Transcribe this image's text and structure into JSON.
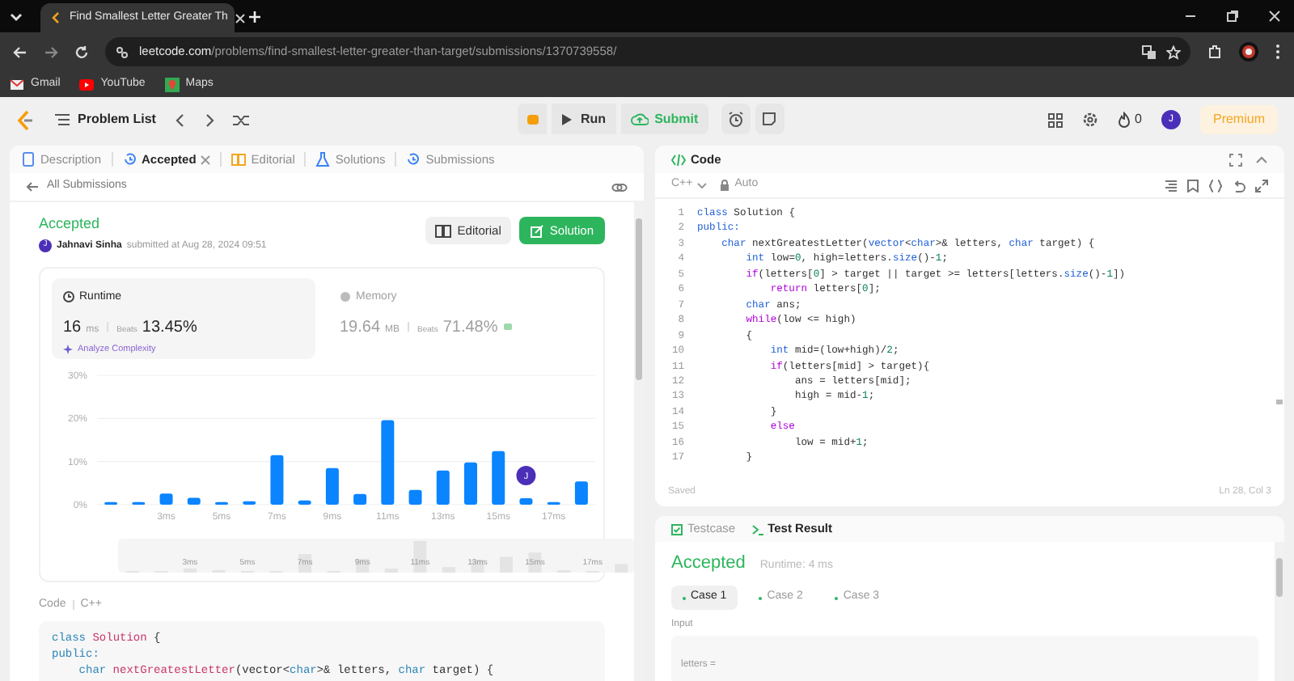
{
  "browser": {
    "tab_title": "Find Smallest Letter Greater Th",
    "url_host": "leetcode.com",
    "url_path": "/problems/find-smallest-letter-greater-than-target/submissions/1370739558/",
    "bookmarks": [
      "Gmail",
      "YouTube",
      "Maps"
    ]
  },
  "nav": {
    "problem_list": "Problem List",
    "run": "Run",
    "submit": "Submit",
    "streak": "0",
    "avatar": "J",
    "premium": "Premium"
  },
  "left_tabs": [
    {
      "label": "Description",
      "selected": false,
      "closable": false
    },
    {
      "label": "Accepted",
      "selected": true,
      "closable": true
    },
    {
      "label": "Editorial",
      "selected": false,
      "closable": false
    },
    {
      "label": "Solutions",
      "selected": false,
      "closable": false
    },
    {
      "label": "Submissions",
      "selected": false,
      "closable": false
    }
  ],
  "back_link": "All Submissions",
  "submission": {
    "status": "Accepted",
    "avatar": "J",
    "user": "Jahnavi Sinha",
    "submitted": "submitted at Aug 28, 2024 09:51",
    "editorial": "Editorial",
    "solution": "Solution"
  },
  "runtime": {
    "label": "Runtime",
    "value": "16",
    "unit": "ms",
    "beats_label": "Beats",
    "beats": "13.45%",
    "analyze": "Analyze Complexity",
    "selected": true
  },
  "memory": {
    "label": "Memory",
    "value": "19.64",
    "unit": "MB",
    "beats_label": "Beats",
    "beats": "71.48%",
    "selected": false
  },
  "chart_data": {
    "type": "bar",
    "x": [
      1,
      2,
      3,
      4,
      5,
      6,
      7,
      8,
      9,
      10,
      11,
      12,
      13,
      14,
      15,
      16,
      17,
      18
    ],
    "xlim": [
      0.5,
      18.5
    ],
    "series": [
      {
        "color": "#0a84ff",
        "values": [
          0.6,
          0.6,
          2.6,
          1.6,
          0.6,
          0.8,
          11.5,
          1,
          8.5,
          2.5,
          19.6,
          3.4,
          7.9,
          9.8,
          12.4,
          1.5,
          0.6,
          5.4
        ]
      }
    ],
    "ylim": [
      0,
      30
    ],
    "yticks": [
      {
        "value": 0,
        "label": "0%"
      },
      {
        "value": 10,
        "label": "10%"
      },
      {
        "value": 20,
        "label": "20%"
      },
      {
        "value": 30,
        "label": "30%"
      }
    ],
    "xticks": [
      {
        "value": 3,
        "label": "3ms"
      },
      {
        "value": 5,
        "label": "5ms"
      },
      {
        "value": 7,
        "label": "7ms"
      },
      {
        "value": 9,
        "label": "9ms"
      },
      {
        "value": 11,
        "label": "11ms"
      },
      {
        "value": 13,
        "label": "13ms"
      },
      {
        "value": 15,
        "label": "15ms"
      },
      {
        "value": 17,
        "label": "17ms"
      }
    ],
    "annotations": [
      {
        "x": 16,
        "text": "J"
      }
    ]
  },
  "brush_labels": [
    "3ms",
    "5ms",
    "7ms",
    "9ms",
    "11ms",
    "13ms",
    "15ms",
    "17ms"
  ],
  "code_section": {
    "label": "Code",
    "language": "C++",
    "lines": [
      [
        {
          "text": "class",
          "kind": "keyword"
        },
        {
          "text": " Solution",
          "kind": "name"
        },
        {
          "text": " {",
          "kind": "plain"
        }
      ],
      [
        {
          "text": "public:",
          "kind": "keyword"
        }
      ],
      [
        {
          "text": "    char",
          "kind": "keyword"
        },
        {
          "text": " nextGreatestLetter",
          "kind": "name"
        },
        {
          "text": "(vector<",
          "kind": "plain"
        },
        {
          "text": "char",
          "kind": "keyword"
        },
        {
          "text": ">& letters, ",
          "kind": "plain"
        },
        {
          "text": "char",
          "kind": "keyword"
        },
        {
          "text": " target) {",
          "kind": "plain"
        }
      ]
    ]
  },
  "editor": {
    "title": "Code",
    "language": "C++",
    "mode": "Auto",
    "status": "Saved",
    "cursor": "Ln 28, Col 3",
    "lines": [
      {
        "number": "1",
        "tokens": [
          {
            "text": "class",
            "kind": "keyword"
          },
          {
            "text": " Solution {",
            "kind": "plain"
          }
        ]
      },
      {
        "number": "2",
        "tokens": [
          {
            "text": "public:",
            "kind": "keyword"
          }
        ]
      },
      {
        "number": "3",
        "tokens": [
          {
            "text": "    char",
            "kind": "keyword"
          },
          {
            "text": " nextGreatestLetter(",
            "kind": "plain"
          },
          {
            "text": "vector",
            "kind": "keyword"
          },
          {
            "text": "<",
            "kind": "plain"
          },
          {
            "text": "char",
            "kind": "keyword"
          },
          {
            "text": ">& letters, ",
            "kind": "plain"
          },
          {
            "text": "char",
            "kind": "keyword"
          },
          {
            "text": " target) {",
            "kind": "plain"
          }
        ]
      },
      {
        "number": "4",
        "tokens": [
          {
            "text": "        int",
            "kind": "keyword"
          },
          {
            "text": " low=",
            "kind": "plain"
          },
          {
            "text": "0",
            "kind": "number"
          },
          {
            "text": ", high=letters.",
            "kind": "plain"
          },
          {
            "text": "size",
            "kind": "keyword"
          },
          {
            "text": "()-",
            "kind": "plain"
          },
          {
            "text": "1",
            "kind": "number"
          },
          {
            "text": ";",
            "kind": "plain"
          }
        ]
      },
      {
        "number": "5",
        "tokens": [
          {
            "text": "        if",
            "kind": "control"
          },
          {
            "text": "(letters[",
            "kind": "plain"
          },
          {
            "text": "0",
            "kind": "number"
          },
          {
            "text": "] > target || target >= letters[letters.",
            "kind": "plain"
          },
          {
            "text": "size",
            "kind": "keyword"
          },
          {
            "text": "()-",
            "kind": "plain"
          },
          {
            "text": "1",
            "kind": "number"
          },
          {
            "text": "])",
            "kind": "plain"
          }
        ]
      },
      {
        "number": "6",
        "tokens": [
          {
            "text": "            return",
            "kind": "control"
          },
          {
            "text": " letters[",
            "kind": "plain"
          },
          {
            "text": "0",
            "kind": "number"
          },
          {
            "text": "];",
            "kind": "plain"
          }
        ]
      },
      {
        "number": "7",
        "tokens": [
          {
            "text": "        char",
            "kind": "keyword"
          },
          {
            "text": " ans;",
            "kind": "plain"
          }
        ]
      },
      {
        "number": "8",
        "tokens": [
          {
            "text": "        while",
            "kind": "control"
          },
          {
            "text": "(low <= high)",
            "kind": "plain"
          }
        ]
      },
      {
        "number": "9",
        "tokens": [
          {
            "text": "        {",
            "kind": "plain"
          }
        ]
      },
      {
        "number": "10",
        "tokens": [
          {
            "text": "            int",
            "kind": "keyword"
          },
          {
            "text": " mid=(low+high)/",
            "kind": "plain"
          },
          {
            "text": "2",
            "kind": "number"
          },
          {
            "text": ";",
            "kind": "plain"
          }
        ]
      },
      {
        "number": "11",
        "tokens": [
          {
            "text": "            if",
            "kind": "control"
          },
          {
            "text": "(letters[mid] > target){",
            "kind": "plain"
          }
        ]
      },
      {
        "number": "12",
        "tokens": [
          {
            "text": "                ans = letters[mid];",
            "kind": "plain"
          }
        ]
      },
      {
        "number": "13",
        "tokens": [
          {
            "text": "                high = mid-",
            "kind": "plain"
          },
          {
            "text": "1",
            "kind": "number"
          },
          {
            "text": ";",
            "kind": "plain"
          }
        ]
      },
      {
        "number": "14",
        "tokens": [
          {
            "text": "            }",
            "kind": "plain"
          }
        ]
      },
      {
        "number": "15",
        "tokens": [
          {
            "text": "            else",
            "kind": "control"
          }
        ]
      },
      {
        "number": "16",
        "tokens": [
          {
            "text": "                low = mid+",
            "kind": "plain"
          },
          {
            "text": "1",
            "kind": "number"
          },
          {
            "text": ";",
            "kind": "plain"
          }
        ]
      },
      {
        "number": "17",
        "tokens": [
          {
            "text": "        }",
            "kind": "plain"
          }
        ]
      }
    ]
  },
  "console": {
    "tabs": [
      {
        "label": "Testcase",
        "selected": false
      },
      {
        "label": "Test Result",
        "selected": true
      }
    ],
    "status": "Accepted",
    "runtime": "Runtime: 4 ms",
    "cases": [
      {
        "label": "Case 1",
        "selected": true
      },
      {
        "label": "Case 2",
        "selected": false
      },
      {
        "label": "Case 3",
        "selected": false
      }
    ],
    "input_label": "Input",
    "input_var": "letters ="
  }
}
